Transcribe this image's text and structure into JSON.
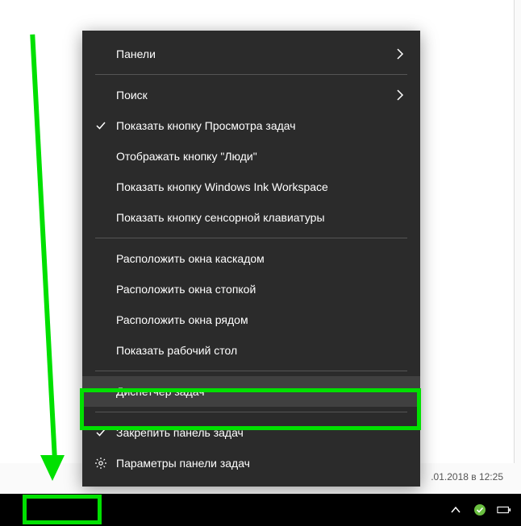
{
  "timestamp_partial": ".01.2018 в 12:25",
  "menu": {
    "group1": [
      {
        "label": "Панели",
        "submenu": true
      },
      {
        "label": "Поиск",
        "submenu": true
      }
    ],
    "group2": [
      {
        "label": "Показать кнопку Просмотра задач",
        "checked": true
      },
      {
        "label": "Отображать кнопку \"Люди\""
      },
      {
        "label": "Показать кнопку Windows Ink Workspace"
      },
      {
        "label": "Показать кнопку сенсорной клавиатуры"
      }
    ],
    "group3": [
      {
        "label": "Расположить окна каскадом"
      },
      {
        "label": "Расположить окна стопкой"
      },
      {
        "label": "Расположить окна рядом"
      },
      {
        "label": "Показать рабочий стол"
      }
    ],
    "group4": [
      {
        "label": "Диспетчер задач",
        "hover": true
      }
    ],
    "group5": [
      {
        "label": "Закрепить панель задач",
        "checked": true
      },
      {
        "label": "Параметры панели задач",
        "icon": "gear"
      }
    ]
  },
  "tray": {
    "chevron": "chevron-up-icon",
    "status": "status-ok-icon",
    "battery": "battery-icon"
  }
}
